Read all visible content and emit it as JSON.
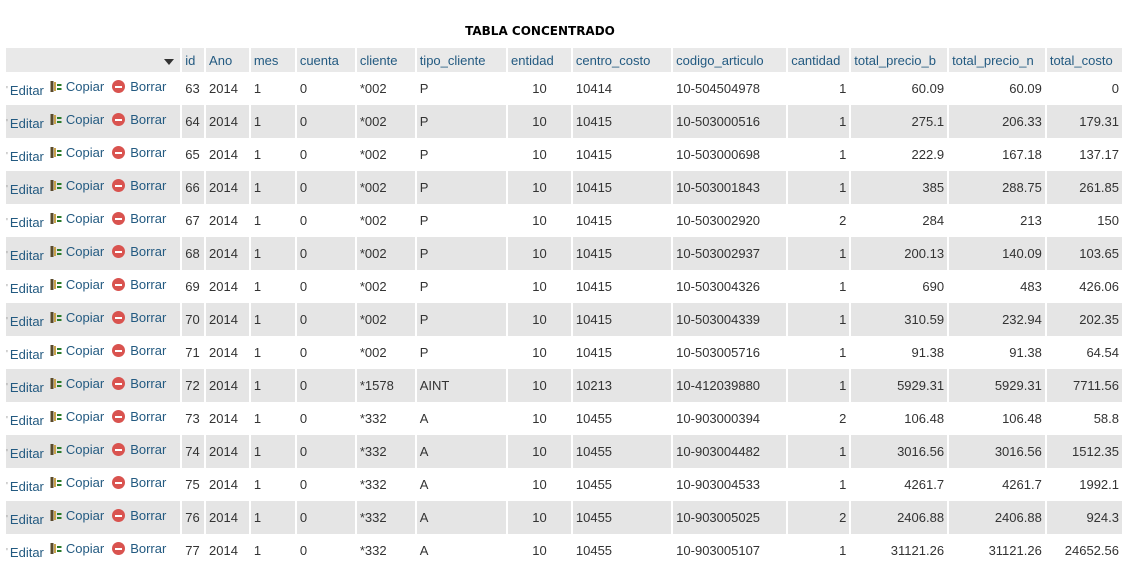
{
  "title": "TABLA CONCENTRADO",
  "actions": {
    "edit": "Editar",
    "copy": "Copiar",
    "delete": "Borrar"
  },
  "columns": [
    "id",
    "Ano",
    "mes",
    "cuenta",
    "cliente",
    "tipo_cliente",
    "entidad",
    "centro_costo",
    "codigo_articulo",
    "cantidad",
    "total_precio_b",
    "total_precio_n",
    "total_costo"
  ],
  "rows": [
    [
      "63",
      "2014",
      "1",
      "0",
      "*002",
      "P",
      "10",
      "10414",
      "10-504504978",
      "1",
      "60.09",
      "60.09",
      "0"
    ],
    [
      "64",
      "2014",
      "1",
      "0",
      "*002",
      "P",
      "10",
      "10415",
      "10-503000516",
      "1",
      "275.1",
      "206.33",
      "179.31"
    ],
    [
      "65",
      "2014",
      "1",
      "0",
      "*002",
      "P",
      "10",
      "10415",
      "10-503000698",
      "1",
      "222.9",
      "167.18",
      "137.17"
    ],
    [
      "66",
      "2014",
      "1",
      "0",
      "*002",
      "P",
      "10",
      "10415",
      "10-503001843",
      "1",
      "385",
      "288.75",
      "261.85"
    ],
    [
      "67",
      "2014",
      "1",
      "0",
      "*002",
      "P",
      "10",
      "10415",
      "10-503002920",
      "2",
      "284",
      "213",
      "150"
    ],
    [
      "68",
      "2014",
      "1",
      "0",
      "*002",
      "P",
      "10",
      "10415",
      "10-503002937",
      "1",
      "200.13",
      "140.09",
      "103.65"
    ],
    [
      "69",
      "2014",
      "1",
      "0",
      "*002",
      "P",
      "10",
      "10415",
      "10-503004326",
      "1",
      "690",
      "483",
      "426.06"
    ],
    [
      "70",
      "2014",
      "1",
      "0",
      "*002",
      "P",
      "10",
      "10415",
      "10-503004339",
      "1",
      "310.59",
      "232.94",
      "202.35"
    ],
    [
      "71",
      "2014",
      "1",
      "0",
      "*002",
      "P",
      "10",
      "10415",
      "10-503005716",
      "1",
      "91.38",
      "91.38",
      "64.54"
    ],
    [
      "72",
      "2014",
      "1",
      "0",
      "*1578",
      "AINT",
      "10",
      "10213",
      "10-412039880",
      "1",
      "5929.31",
      "5929.31",
      "7711.56"
    ],
    [
      "73",
      "2014",
      "1",
      "0",
      "*332",
      "A",
      "10",
      "10455",
      "10-903000394",
      "2",
      "106.48",
      "106.48",
      "58.8"
    ],
    [
      "74",
      "2014",
      "1",
      "0",
      "*332",
      "A",
      "10",
      "10455",
      "10-903004482",
      "1",
      "3016.56",
      "3016.56",
      "1512.35"
    ],
    [
      "75",
      "2014",
      "1",
      "0",
      "*332",
      "A",
      "10",
      "10455",
      "10-903004533",
      "1",
      "4261.7",
      "4261.7",
      "1992.1"
    ],
    [
      "76",
      "2014",
      "1",
      "0",
      "*332",
      "A",
      "10",
      "10455",
      "10-903005025",
      "2",
      "2406.88",
      "2406.88",
      "924.3"
    ],
    [
      "77",
      "2014",
      "1",
      "0",
      "*332",
      "A",
      "10",
      "10455",
      "10-903005107",
      "1",
      "31121.26",
      "31121.26",
      "24652.56"
    ]
  ],
  "colors": {
    "link": "#235a81",
    "stripe": "#e5e5e5",
    "header": "#e9e9e9",
    "delete_icon": "#d9534f"
  },
  "icons": {
    "copy": "copy-icon",
    "delete": "delete-icon",
    "sort": "sort-arrow-icon"
  }
}
